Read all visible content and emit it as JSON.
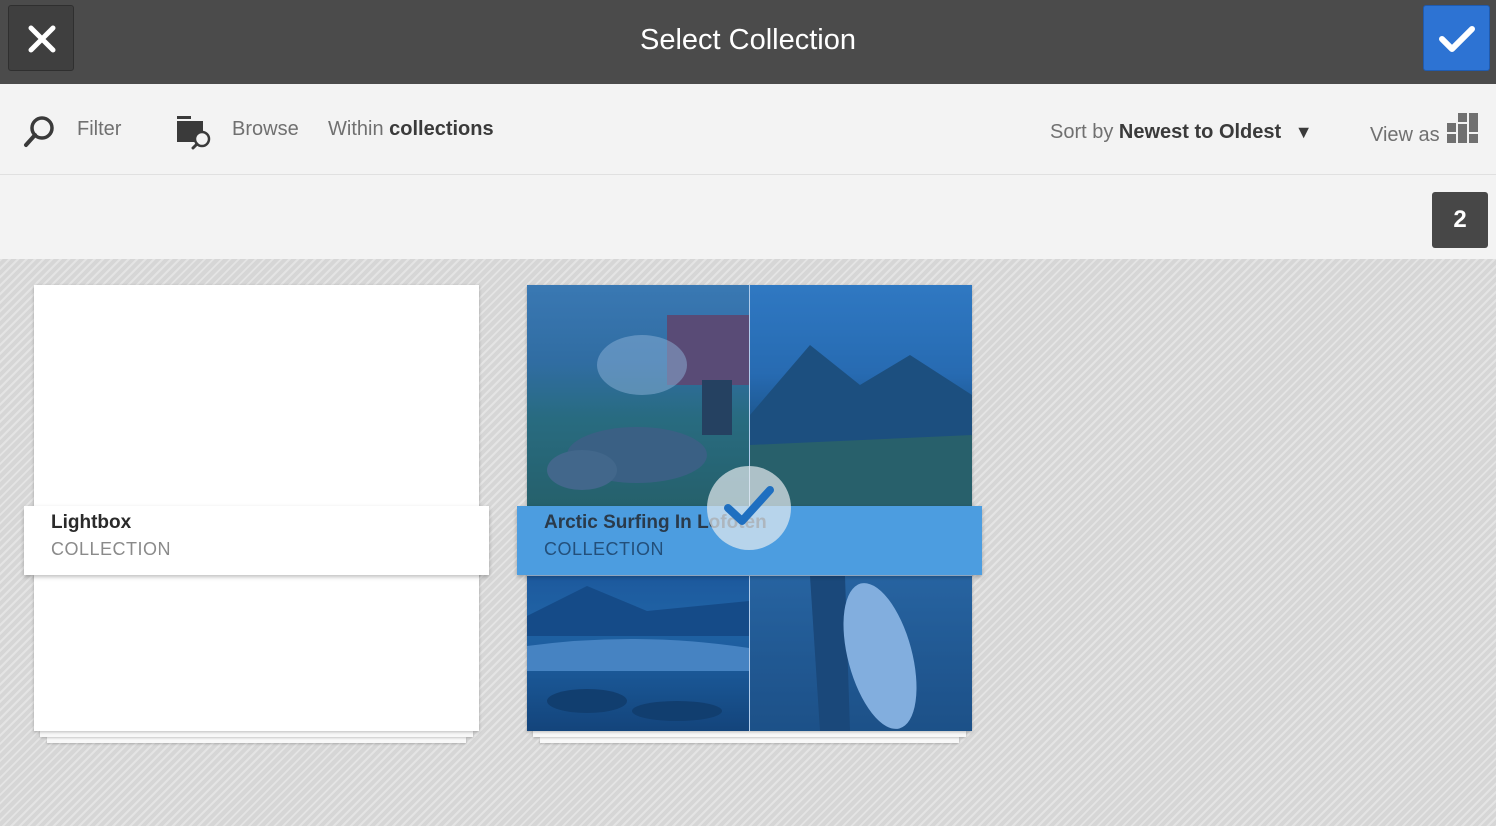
{
  "header": {
    "title": "Select Collection",
    "close_icon": "close-icon",
    "confirm_icon": "checkmark-icon"
  },
  "toolbar": {
    "filter_label": "Filter",
    "browse_label": "Browse",
    "within_prefix": "Within",
    "within_value": "collections",
    "sort_prefix": "Sort by",
    "sort_value": "Newest to Oldest",
    "view_prefix": "View as"
  },
  "selection": {
    "count": "2"
  },
  "collections": [
    {
      "name": "Lightbox",
      "type": "COLLECTION",
      "selected": false
    },
    {
      "name": "Arctic Surfing In Lofoten",
      "type": "COLLECTION",
      "selected": true
    }
  ],
  "colors": {
    "header_bg": "#4b4b4b",
    "accent": "#2d73d3",
    "selected_label": "#4c9de0"
  }
}
